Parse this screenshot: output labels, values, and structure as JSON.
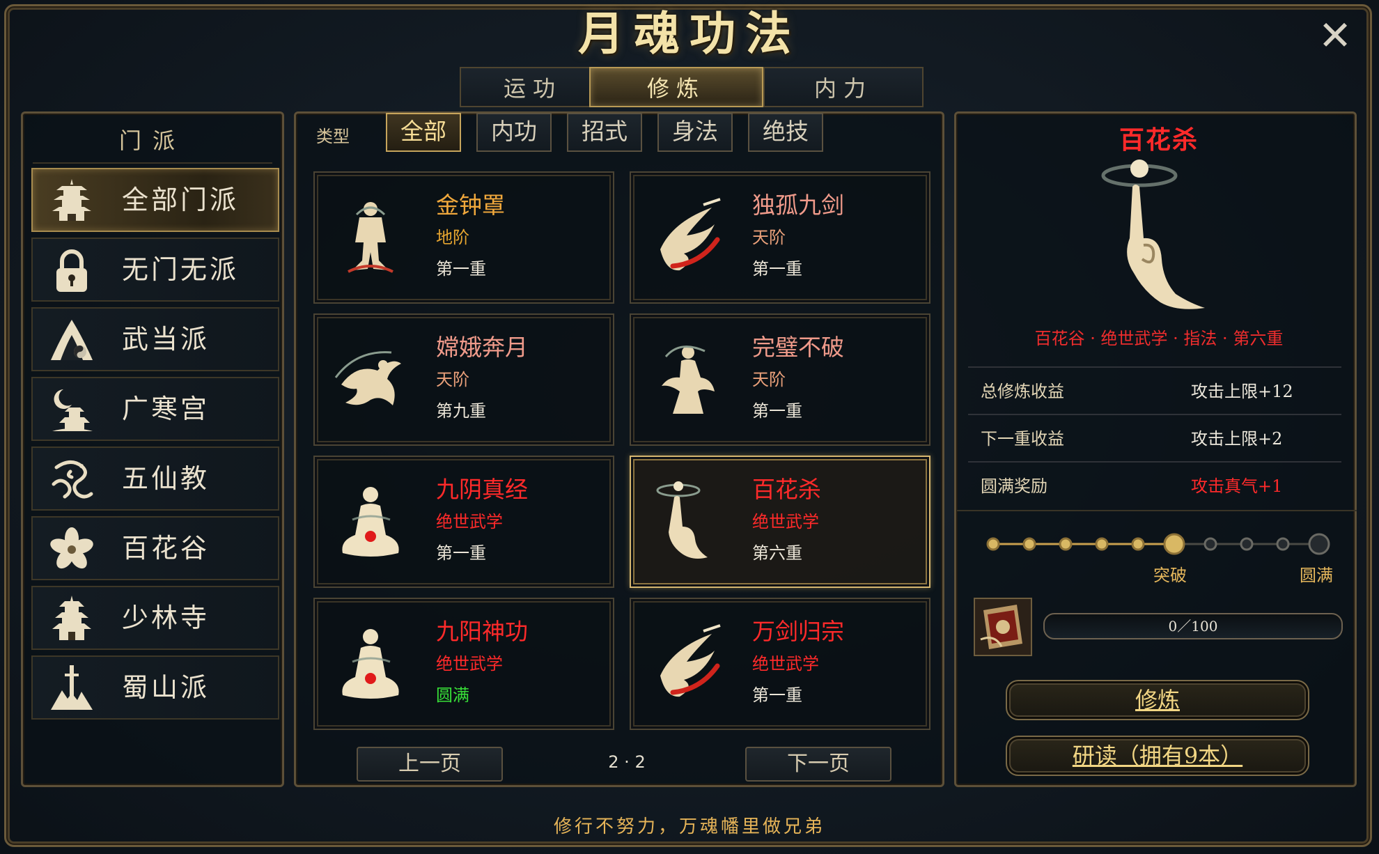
{
  "window": {
    "title": "月魂功法",
    "close_glyph": "✕"
  },
  "tabs": [
    {
      "label": "运功",
      "active": false
    },
    {
      "label": "修炼",
      "active": true
    },
    {
      "label": "内力",
      "active": false
    }
  ],
  "sects": {
    "header": "门派",
    "items": [
      {
        "label": "全部门派",
        "icon": "pagoda-icon",
        "active": true
      },
      {
        "label": "无门无派",
        "icon": "lock-icon",
        "active": false
      },
      {
        "label": "武当派",
        "icon": "wudang-mountain-icon",
        "active": false
      },
      {
        "label": "广寒宫",
        "icon": "moon-palace-icon",
        "active": false
      },
      {
        "label": "五仙教",
        "icon": "dragon-icon",
        "active": false
      },
      {
        "label": "百花谷",
        "icon": "flower-icon",
        "active": false
      },
      {
        "label": "少林寺",
        "icon": "temple-icon",
        "active": false
      },
      {
        "label": "蜀山派",
        "icon": "sword-mountain-icon",
        "active": false
      }
    ]
  },
  "filters": {
    "label": "类型",
    "items": [
      {
        "label": "全部",
        "active": true
      },
      {
        "label": "内功",
        "active": false
      },
      {
        "label": "招式",
        "active": false
      },
      {
        "label": "身法",
        "active": false
      },
      {
        "label": "绝技",
        "active": false
      }
    ]
  },
  "skills": [
    {
      "name": "金钟罩",
      "tier": "地阶",
      "level": "第一重",
      "art": "monk-stance-icon",
      "name_color": "#f0a83c",
      "tier_color": "#e6a530",
      "level_color": "#ece6d8"
    },
    {
      "name": "独孤九剑",
      "tier": "天阶",
      "level": "第一重",
      "art": "sword-slash-icon",
      "name_color": "#ef9a8a",
      "tier_color": "#e9a07a",
      "level_color": "#ece6d8"
    },
    {
      "name": "嫦娥奔月",
      "tier": "天阶",
      "level": "第九重",
      "art": "flying-fairy-icon",
      "name_color": "#ef9a8a",
      "tier_color": "#e9a07a",
      "level_color": "#ece6d8"
    },
    {
      "name": "完璧不破",
      "tier": "天阶",
      "level": "第一重",
      "art": "dancer-icon",
      "name_color": "#ef9a8a",
      "tier_color": "#e9a07a",
      "level_color": "#ece6d8"
    },
    {
      "name": "九阴真经",
      "tier": "绝世武学",
      "level": "第一重",
      "art": "meditation-icon",
      "name_color": "#ff2a2a",
      "tier_color": "#ff2a2a",
      "level_color": "#ece6d8"
    },
    {
      "name": "百花杀",
      "tier": "绝世武学",
      "level": "第六重",
      "art": "finger-mudra-icon",
      "name_color": "#ff2a2a",
      "tier_color": "#ff2a2a",
      "level_color": "#ece6d8",
      "selected": true
    },
    {
      "name": "九阳神功",
      "tier": "绝世武学",
      "level": "圆满",
      "art": "meditation-icon",
      "name_color": "#ff2a2a",
      "tier_color": "#ff2a2a",
      "level_color": "#38e038"
    },
    {
      "name": "万剑归宗",
      "tier": "绝世武学",
      "level": "第一重",
      "art": "sword-slash-icon",
      "name_color": "#ff2a2a",
      "tier_color": "#ff2a2a",
      "level_color": "#ece6d8"
    }
  ],
  "pager": {
    "prev": "上一页",
    "next": "下一页",
    "indicator": "2 · 2"
  },
  "detail": {
    "title": "百花杀",
    "art": "finger-mudra-icon",
    "subtitle": "百花谷 · 绝世武学 · 指法 · 第六重",
    "stats": [
      {
        "key": "总修炼收益",
        "value": "攻击上限+12",
        "value_color": "#ede8dc"
      },
      {
        "key": "下一重收益",
        "value": "攻击上限+2",
        "value_color": "#ede8dc"
      },
      {
        "key": "圆满奖励",
        "value": "攻击真气+1",
        "value_color": "#ff2a2a"
      }
    ],
    "progress_nodes": {
      "total": 10,
      "filled": 5,
      "breakthrough_index": 6
    },
    "node_labels": {
      "breakthrough": "突破",
      "perfect": "圆满"
    },
    "item_icon": "scroll-book-icon",
    "exp": {
      "current": 0,
      "max": 100,
      "text": "0／100"
    },
    "cultivate_button": "修炼",
    "study_button": "研读（拥有9本）"
  },
  "motto": "修行不努力，万魂幡里做兄弟",
  "colors": {
    "gold": "#f3e2a8",
    "frame": "#6b5a3a",
    "accent_red": "#ff2a2a",
    "complete_green": "#38e038"
  }
}
